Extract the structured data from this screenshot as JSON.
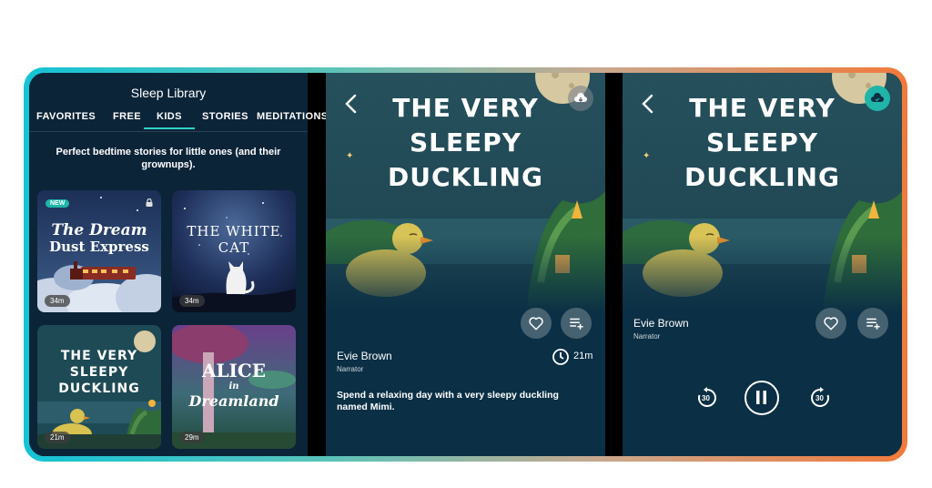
{
  "library": {
    "title": "Sleep Library",
    "tabs": [
      "FAVORITES",
      "FREE",
      "KIDS",
      "STORIES",
      "MEDITATIONS"
    ],
    "active_tab": "KIDS",
    "description": "Perfect bedtime stories for little ones (and their grownups).",
    "cards": [
      {
        "title_line1": "The Dream",
        "title_line2": "Dust Express",
        "duration": "34m",
        "badge": "NEW"
      },
      {
        "title_line1": "THE WHITE CAT",
        "duration": "34m"
      },
      {
        "title_line1": "THE VERY",
        "title_line2": "SLEEPY",
        "title_line3": "DUCKLING",
        "duration": "21m"
      },
      {
        "title_line1": "ALICE",
        "title_line2": "in",
        "title_line3": "Dreamland",
        "duration": "29m"
      }
    ]
  },
  "story_detail": {
    "title_line1": "THE VERY",
    "title_line2": "SLEEPY",
    "title_line3": "DUCKLING",
    "narrator": "Evie Brown",
    "narrator_role": "Narrator",
    "duration": "21m",
    "description": "Spend a relaxing day with a very sleepy duckling named Mimi."
  },
  "player": {
    "title_line1": "THE VERY",
    "title_line2": "SLEEPY",
    "title_line3": "DUCKLING",
    "narrator": "Evie Brown",
    "narrator_role": "Narrator",
    "rewind_label": "30",
    "forward_label": "30"
  },
  "icons": [
    "back-icon",
    "cloud-download-icon",
    "heart-icon",
    "playlist-add-icon",
    "clock-icon",
    "rewind-30-icon",
    "pause-icon",
    "forward-30-icon",
    "lock-icon"
  ],
  "colors": {
    "accent": "#2fd1c5",
    "panel_bg": "#0c2438",
    "story_bg": "#0b2f45",
    "badge": "#1fb5a8",
    "frame_start": "#14c3d6",
    "frame_end": "#f07a3c"
  }
}
